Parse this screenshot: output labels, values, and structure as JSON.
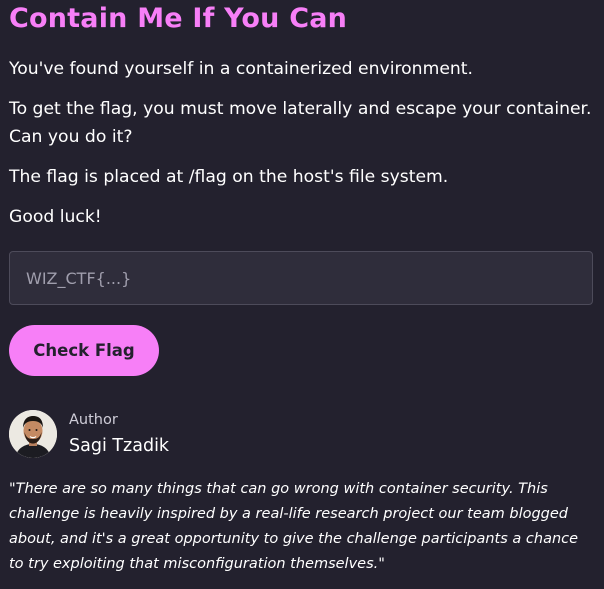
{
  "challenge": {
    "title": "Contain Me If You Can",
    "paragraphs": [
      "You've found yourself in a containerized environment.",
      "To get the flag, you must move laterally and escape your container.",
      "Can you do it?",
      "The flag is placed at /flag on the host's file system.",
      "Good luck!"
    ]
  },
  "flag_form": {
    "input_placeholder": "WIZ_CTF{...}",
    "input_value": "",
    "submit_label": "Check Flag"
  },
  "author": {
    "label": "Author",
    "name": "Sagi Tzadik",
    "avatar_icon": "author-avatar-photo"
  },
  "quote": "\"There are so many things that can go wrong with container security. This challenge is heavily inspired by a real-life research project our team blogged about, and it's a great opportunity to give the challenge participants a chance to try exploiting that misconfiguration themselves.\"",
  "colors": {
    "background": "#23212e",
    "accent": "#f77ff7",
    "input_background": "#2f2d3b",
    "input_border": "#4d4b5a",
    "text": "#ffffff",
    "muted_text": "#cfcdd8"
  }
}
